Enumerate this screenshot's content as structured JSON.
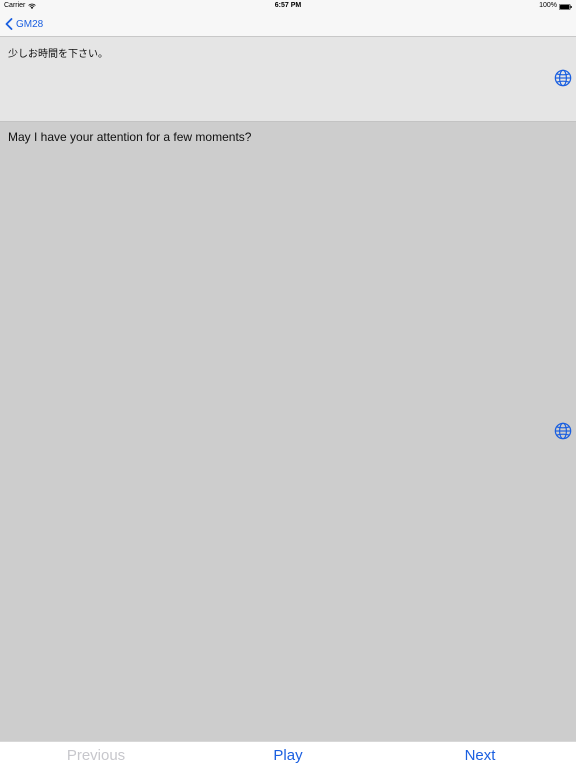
{
  "status_bar": {
    "carrier": "Carrier",
    "time": "6:57 PM",
    "battery": "100%"
  },
  "nav": {
    "back_label": "GM28"
  },
  "source": {
    "text": "少しお時間を下さい。"
  },
  "translation": {
    "text": "May I have your attention for a few moments?"
  },
  "toolbar": {
    "previous_label": "Previous",
    "play_label": "Play",
    "next_label": "Next"
  },
  "colors": {
    "accent": "#1a5fe0",
    "disabled": "#c7c7cc",
    "source_bg": "#e5e5e5",
    "translation_bg": "#cdcdcd"
  }
}
